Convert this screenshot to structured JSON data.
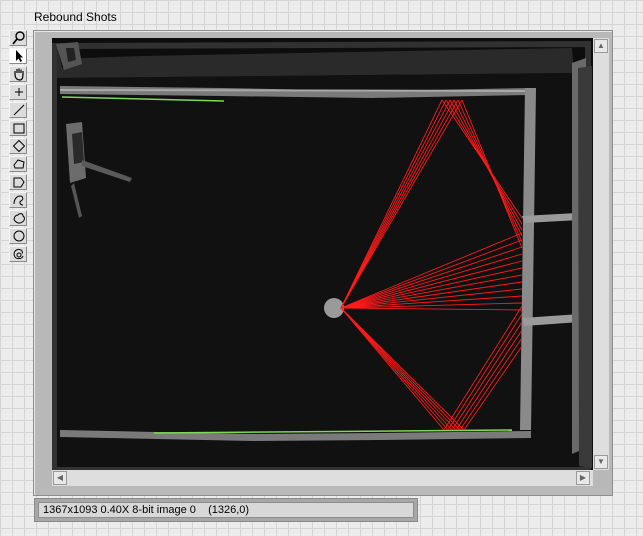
{
  "control_label": "Rebound Shots",
  "status_bar": {
    "text": "1367x1093 0.40X 8-bit image 0    (1326,0)"
  },
  "tools": [
    {
      "name": "zoom-icon",
      "selected": false
    },
    {
      "name": "pointer-icon",
      "selected": true
    },
    {
      "name": "pan-hand-icon",
      "selected": false
    },
    {
      "name": "point-icon",
      "selected": false
    },
    {
      "name": "line-icon",
      "selected": false
    },
    {
      "name": "rectangle-icon",
      "selected": false
    },
    {
      "name": "rotated-rectangle-icon",
      "selected": false
    },
    {
      "name": "polygon-icon",
      "selected": false
    },
    {
      "name": "broken-line-icon",
      "selected": false
    },
    {
      "name": "freehand-line-icon",
      "selected": false
    },
    {
      "name": "freehand-region-icon",
      "selected": false
    },
    {
      "name": "oval-icon",
      "selected": false
    },
    {
      "name": "annulus-icon",
      "selected": false
    }
  ],
  "colors": {
    "trajectory": "#ff1a1a",
    "detected_edge": "#7ed957",
    "ball": "#9a9a9a"
  }
}
